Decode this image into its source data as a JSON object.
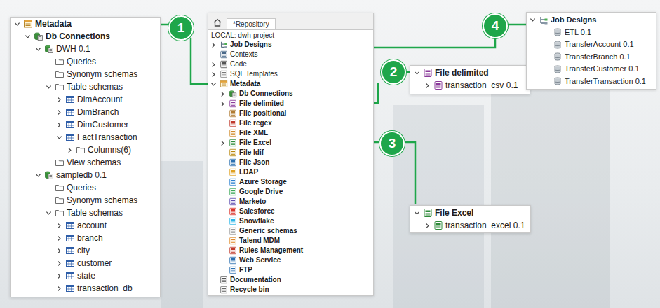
{
  "left_panel": {
    "items": [
      {
        "label": "Metadata",
        "depth": 0,
        "expandable": true,
        "expanded": true,
        "bold": true,
        "icon": "metadata"
      },
      {
        "label": "Db Connections",
        "depth": 1,
        "expandable": true,
        "expanded": true,
        "bold": true,
        "icon": "db"
      },
      {
        "label": "DWH 0.1",
        "depth": 2,
        "expandable": true,
        "expanded": true,
        "bold": false,
        "icon": "db"
      },
      {
        "label": "Queries",
        "depth": 3,
        "expandable": false,
        "expanded": false,
        "bold": false,
        "icon": "folder"
      },
      {
        "label": "Synonym schemas",
        "depth": 3,
        "expandable": false,
        "expanded": false,
        "bold": false,
        "icon": "folder"
      },
      {
        "label": "Table schemas",
        "depth": 3,
        "expandable": true,
        "expanded": true,
        "bold": false,
        "icon": "folder"
      },
      {
        "label": "DimAccount",
        "depth": 4,
        "expandable": true,
        "expanded": false,
        "bold": false,
        "icon": "table"
      },
      {
        "label": "DimBranch",
        "depth": 4,
        "expandable": true,
        "expanded": false,
        "bold": false,
        "icon": "table"
      },
      {
        "label": "DimCustomer",
        "depth": 4,
        "expandable": true,
        "expanded": false,
        "bold": false,
        "icon": "table"
      },
      {
        "label": "FactTransaction",
        "depth": 4,
        "expandable": true,
        "expanded": true,
        "bold": false,
        "icon": "table"
      },
      {
        "label": "Columns(6)",
        "depth": 5,
        "expandable": true,
        "expanded": false,
        "bold": false,
        "icon": "folder"
      },
      {
        "label": "View schemas",
        "depth": 3,
        "expandable": false,
        "expanded": false,
        "bold": false,
        "icon": "folder"
      },
      {
        "label": "sampledb 0.1",
        "depth": 2,
        "expandable": true,
        "expanded": true,
        "bold": false,
        "icon": "db"
      },
      {
        "label": "Queries",
        "depth": 3,
        "expandable": false,
        "expanded": false,
        "bold": false,
        "icon": "folder"
      },
      {
        "label": "Synonym schemas",
        "depth": 3,
        "expandable": false,
        "expanded": false,
        "bold": false,
        "icon": "folder"
      },
      {
        "label": "Table schemas",
        "depth": 3,
        "expandable": true,
        "expanded": true,
        "bold": false,
        "icon": "folder"
      },
      {
        "label": "account",
        "depth": 4,
        "expandable": true,
        "expanded": false,
        "bold": false,
        "icon": "table"
      },
      {
        "label": "branch",
        "depth": 4,
        "expandable": true,
        "expanded": false,
        "bold": false,
        "icon": "table"
      },
      {
        "label": "city",
        "depth": 4,
        "expandable": true,
        "expanded": false,
        "bold": false,
        "icon": "table"
      },
      {
        "label": "customer",
        "depth": 4,
        "expandable": true,
        "expanded": false,
        "bold": false,
        "icon": "table"
      },
      {
        "label": "state",
        "depth": 4,
        "expandable": true,
        "expanded": false,
        "bold": false,
        "icon": "table"
      },
      {
        "label": "transaction_db",
        "depth": 4,
        "expandable": true,
        "expanded": false,
        "bold": false,
        "icon": "table"
      }
    ]
  },
  "repository": {
    "tab": "*Repository",
    "project": "LOCAL: dwh-project",
    "items": [
      {
        "label": "Job Designs",
        "depth": 0,
        "expandable": true,
        "expanded": false,
        "bold": true,
        "icon": "job"
      },
      {
        "label": "Contexts",
        "depth": 0,
        "expandable": false,
        "expanded": false,
        "bold": false,
        "icon": "contexts"
      },
      {
        "label": "Code",
        "depth": 0,
        "expandable": true,
        "expanded": false,
        "bold": false,
        "icon": "code"
      },
      {
        "label": "SQL Templates",
        "depth": 0,
        "expandable": true,
        "expanded": false,
        "bold": false,
        "icon": "sql"
      },
      {
        "label": "Metadata",
        "depth": 0,
        "expandable": true,
        "expanded": true,
        "bold": true,
        "icon": "metadata"
      },
      {
        "label": "Db Connections",
        "depth": 1,
        "expandable": true,
        "expanded": false,
        "bold": true,
        "icon": "db"
      },
      {
        "label": "File delimited",
        "depth": 1,
        "expandable": true,
        "expanded": false,
        "bold": true,
        "icon": "delimited"
      },
      {
        "label": "File positional",
        "depth": 1,
        "expandable": false,
        "expanded": false,
        "bold": true,
        "icon": "positional"
      },
      {
        "label": "File regex",
        "depth": 1,
        "expandable": false,
        "expanded": false,
        "bold": true,
        "icon": "regex"
      },
      {
        "label": "File XML",
        "depth": 1,
        "expandable": false,
        "expanded": false,
        "bold": true,
        "icon": "xml"
      },
      {
        "label": "File Excel",
        "depth": 1,
        "expandable": true,
        "expanded": false,
        "bold": true,
        "icon": "excel"
      },
      {
        "label": "File ldif",
        "depth": 1,
        "expandable": false,
        "expanded": false,
        "bold": true,
        "icon": "ldif"
      },
      {
        "label": "File Json",
        "depth": 1,
        "expandable": false,
        "expanded": false,
        "bold": true,
        "icon": "json"
      },
      {
        "label": "LDAP",
        "depth": 1,
        "expandable": false,
        "expanded": false,
        "bold": true,
        "icon": "ldap"
      },
      {
        "label": "Azure Storage",
        "depth": 1,
        "expandable": false,
        "expanded": false,
        "bold": true,
        "icon": "azure"
      },
      {
        "label": "Google Drive",
        "depth": 1,
        "expandable": false,
        "expanded": false,
        "bold": true,
        "icon": "gdrive"
      },
      {
        "label": "Marketo",
        "depth": 1,
        "expandable": false,
        "expanded": false,
        "bold": true,
        "icon": "marketo"
      },
      {
        "label": "Salesforce",
        "depth": 1,
        "expandable": false,
        "expanded": false,
        "bold": true,
        "icon": "salesforce"
      },
      {
        "label": "Snowflake",
        "depth": 1,
        "expandable": false,
        "expanded": false,
        "bold": true,
        "icon": "snowflake"
      },
      {
        "label": "Generic schemas",
        "depth": 1,
        "expandable": false,
        "expanded": false,
        "bold": true,
        "icon": "generic"
      },
      {
        "label": "Talend MDM",
        "depth": 1,
        "expandable": false,
        "expanded": false,
        "bold": true,
        "icon": "mdm"
      },
      {
        "label": "Rules Management",
        "depth": 1,
        "expandable": false,
        "expanded": false,
        "bold": true,
        "icon": "rules"
      },
      {
        "label": "Web Service",
        "depth": 1,
        "expandable": false,
        "expanded": false,
        "bold": true,
        "icon": "webservice"
      },
      {
        "label": "FTP",
        "depth": 1,
        "expandable": false,
        "expanded": false,
        "bold": true,
        "icon": "ftp"
      },
      {
        "label": "Documentation",
        "depth": 0,
        "expandable": false,
        "expanded": false,
        "bold": true,
        "icon": "documentation"
      },
      {
        "label": "Recycle bin",
        "depth": 0,
        "expandable": false,
        "expanded": false,
        "bold": true,
        "icon": "recycle"
      }
    ]
  },
  "file_delimited_panel": {
    "items": [
      {
        "label": "File delimited",
        "depth": 0,
        "expandable": true,
        "expanded": true,
        "bold": true,
        "icon": "delimited"
      },
      {
        "label": "transaction_csv 0.1",
        "depth": 1,
        "expandable": true,
        "expanded": false,
        "bold": false,
        "icon": "delimited"
      }
    ]
  },
  "file_excel_panel": {
    "items": [
      {
        "label": "File Excel",
        "depth": 0,
        "expandable": true,
        "expanded": true,
        "bold": true,
        "icon": "excel"
      },
      {
        "label": "transaction_excel 0.1",
        "depth": 1,
        "expandable": true,
        "expanded": false,
        "bold": false,
        "icon": "excel"
      }
    ]
  },
  "job_designs_panel": {
    "items": [
      {
        "label": "Job Designs",
        "depth": 0,
        "expandable": true,
        "expanded": true,
        "bold": true,
        "icon": "job"
      },
      {
        "label": "ETL 0.1",
        "depth": 1,
        "expandable": false,
        "expanded": false,
        "bold": false,
        "icon": "jobitem"
      },
      {
        "label": "TransferAccount 0.1",
        "depth": 1,
        "expandable": false,
        "expanded": false,
        "bold": false,
        "icon": "jobitem"
      },
      {
        "label": "TransferBranch 0.1",
        "depth": 1,
        "expandable": false,
        "expanded": false,
        "bold": false,
        "icon": "jobitem"
      },
      {
        "label": "TransferCustomer 0.1",
        "depth": 1,
        "expandable": false,
        "expanded": false,
        "bold": false,
        "icon": "jobitem"
      },
      {
        "label": "TransferTransaction 0.1",
        "depth": 1,
        "expandable": false,
        "expanded": false,
        "bold": false,
        "icon": "jobitem"
      }
    ]
  },
  "callouts": [
    {
      "number": "1"
    },
    {
      "number": "2"
    },
    {
      "number": "3"
    },
    {
      "number": "4"
    }
  ]
}
